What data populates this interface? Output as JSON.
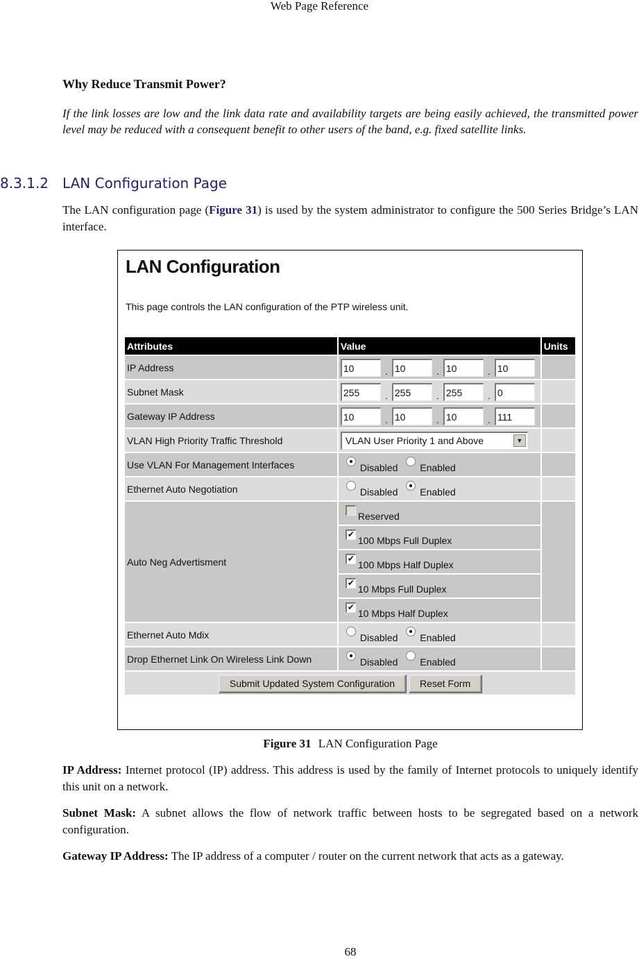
{
  "running_head": "Web Page Reference",
  "section_question": "Why Reduce Transmit Power?",
  "italic_paragraph": "If the link losses are low and the link data rate and availability targets are being easily achieved, the transmitted power level may be reduced with a consequent benefit to other users of the band, e.g. fixed satellite links.",
  "subsection": {
    "number": "8.3.1.2",
    "title": "LAN Configuration Page"
  },
  "intro": {
    "before": "The LAN configuration page (",
    "figref": "Figure 31",
    "after": ") is used by the system administrator to configure the 500 Series Bridge’s LAN interface."
  },
  "figure": {
    "title": "LAN Configuration",
    "description": "This page controls the LAN configuration of the PTP wireless unit.",
    "headers": {
      "attributes": "Attributes",
      "value": "Value",
      "units": "Units"
    },
    "ip_address": {
      "label": "IP Address",
      "octets": [
        "10",
        "10",
        "10",
        "10"
      ]
    },
    "subnet_mask": {
      "label": "Subnet Mask",
      "octets": [
        "255",
        "255",
        "255",
        "0"
      ]
    },
    "gateway": {
      "label": "Gateway IP Address",
      "octets": [
        "10",
        "10",
        "10",
        "111"
      ]
    },
    "octet_separator": ".",
    "vlan_threshold": {
      "label": "VLAN High Priority Traffic Threshold",
      "selected": "VLAN User Priority 1 and Above",
      "arrow": "▼"
    },
    "use_vlan_mgmt": {
      "label": "Use VLAN For Management Interfaces",
      "options": [
        "Disabled",
        "Enabled"
      ],
      "selected": "Disabled"
    },
    "eth_auto_neg": {
      "label": "Ethernet Auto Negotiation",
      "options": [
        "Disabled",
        "Enabled"
      ],
      "selected": "Enabled"
    },
    "auto_neg_adv": {
      "label": "Auto Neg Advertisment",
      "options": [
        {
          "label": "Reserved",
          "checked": false
        },
        {
          "label": "100 Mbps Full Duplex",
          "checked": true
        },
        {
          "label": "100 Mbps Half Duplex",
          "checked": true
        },
        {
          "label": "10 Mbps Full Duplex",
          "checked": true
        },
        {
          "label": "10 Mbps Half Duplex",
          "checked": true
        }
      ],
      "check_glyph": "✔"
    },
    "eth_auto_mdix": {
      "label": "Ethernet Auto Mdix",
      "options": [
        "Disabled",
        "Enabled"
      ],
      "selected": "Enabled"
    },
    "drop_eth_link": {
      "label": "Drop Ethernet Link On Wireless Link Down",
      "options": [
        "Disabled",
        "Enabled"
      ],
      "selected": "Disabled"
    },
    "buttons": {
      "submit": "Submit Updated System Configuration",
      "reset": "Reset Form"
    }
  },
  "caption": {
    "label": "Figure 31",
    "text": "LAN Configuration Page"
  },
  "definitions": [
    {
      "term": "IP Address:",
      "text": " Internet protocol (IP) address.  This address is used by the family of Internet protocols to uniquely identify this unit on a network."
    },
    {
      "term": "Subnet Mask:",
      "text": " A subnet allows the flow of network traffic between hosts to be segregated based on a network configuration."
    },
    {
      "term": "Gateway IP Address:",
      "text": " The IP address of a computer / router on the current network that acts as a gateway."
    }
  ],
  "page_number": "68"
}
